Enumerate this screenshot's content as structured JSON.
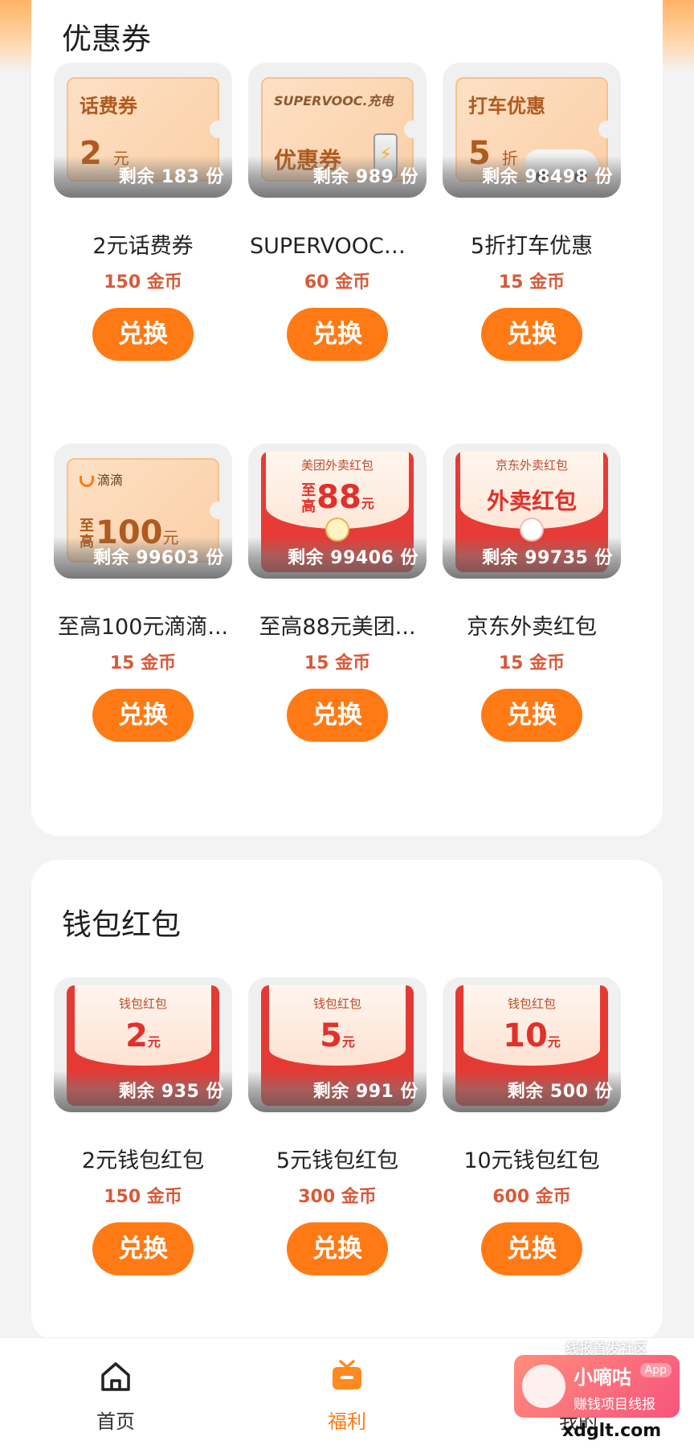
{
  "sections": {
    "coupons_title": "优惠券",
    "wallet_title": "钱包红包"
  },
  "coupons": [
    {
      "name": "2元话费券",
      "price": "150 金币",
      "remain": "剩余 183 份",
      "button": "兑换",
      "art_title": "话费券",
      "art_value": "2",
      "art_unit": "元"
    },
    {
      "name": "SUPERVOOC充...",
      "price": "60 金币",
      "remain": "剩余 989 份",
      "button": "兑换",
      "art_title": "SUPERVOOC.充电",
      "art_value": "优惠券"
    },
    {
      "name": "5折打车优惠",
      "price": "15 金币",
      "remain": "剩余 98498 份",
      "button": "兑换",
      "art_title": "打车优惠",
      "art_value": "5",
      "art_unit": "折"
    },
    {
      "name": "至高100元滴滴...",
      "price": "15 金币",
      "remain": "剩余 99603 份",
      "button": "兑换",
      "art_title": "滴滴",
      "art_prefix": "至高",
      "art_value": "100",
      "art_unit": "元"
    },
    {
      "name": "至高88元美团...",
      "price": "15 金币",
      "remain": "剩余 99406 份",
      "button": "兑换",
      "art_title": "美团外卖红包",
      "art_prefix": "至高",
      "art_value": "88",
      "art_unit": "元"
    },
    {
      "name": "京东外卖红包",
      "price": "15 金币",
      "remain": "剩余 99735 份",
      "button": "兑换",
      "art_title": "京东外卖红包",
      "art_value": "外卖红包"
    }
  ],
  "wallet": [
    {
      "name": "2元钱包红包",
      "price": "150 金币",
      "remain": "剩余 935 份",
      "button": "兑换",
      "art_title": "钱包红包",
      "art_value": "2",
      "art_unit": "元"
    },
    {
      "name": "5元钱包红包",
      "price": "300 金币",
      "remain": "剩余 991 份",
      "button": "兑换",
      "art_title": "钱包红包",
      "art_value": "5",
      "art_unit": "元"
    },
    {
      "name": "10元钱包红包",
      "price": "600 金币",
      "remain": "剩余 500 份",
      "button": "兑换",
      "art_title": "钱包红包",
      "art_value": "10",
      "art_unit": "元"
    }
  ],
  "nav": {
    "home": "首页",
    "welfare": "福利",
    "me": "我的",
    "active": "福利"
  },
  "watermark": {
    "top": "线报首发社区",
    "title": "小嘀咕",
    "app": "App",
    "sub": "赚钱项目线报",
    "url": "xdglt.com"
  },
  "colors": {
    "accent": "#ff7a14",
    "price": "#d85a3a",
    "envelope_red": "#e63b36"
  }
}
